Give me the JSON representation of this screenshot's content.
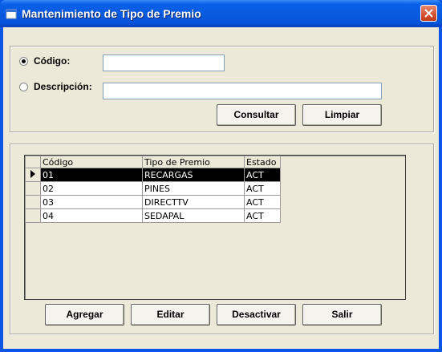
{
  "window": {
    "title": "Mantenimiento de Tipo de Premio"
  },
  "search": {
    "codigo_label": "Código:",
    "codigo_value": "",
    "descripcion_label": "Descripción:",
    "descripcion_value": "",
    "selected_option": "codigo",
    "consultar_label": "Consultar",
    "limpiar_label": "Limpiar"
  },
  "grid": {
    "columns": [
      "Código",
      "Tipo de Premio",
      "Estado"
    ],
    "rows": [
      {
        "codigo": "01",
        "tipo": "RECARGAS",
        "estado": "ACT",
        "selected": true
      },
      {
        "codigo": "02",
        "tipo": "PINES",
        "estado": "ACT",
        "selected": false
      },
      {
        "codigo": "03",
        "tipo": "DIRECTTV",
        "estado": "ACT",
        "selected": false
      },
      {
        "codigo": "04",
        "tipo": "SEDAPAL",
        "estado": "ACT",
        "selected": false
      }
    ]
  },
  "actions": {
    "agregar_label": "Agregar",
    "editar_label": "Editar",
    "desactivar_label": "Desactivar",
    "salir_label": "Salir"
  },
  "icons": {
    "title_icon": "window-app-icon",
    "close_icon": "close-icon"
  },
  "colors": {
    "titlebar": "#0a5be0",
    "client": "#ece9d8",
    "selection": "#000000"
  }
}
